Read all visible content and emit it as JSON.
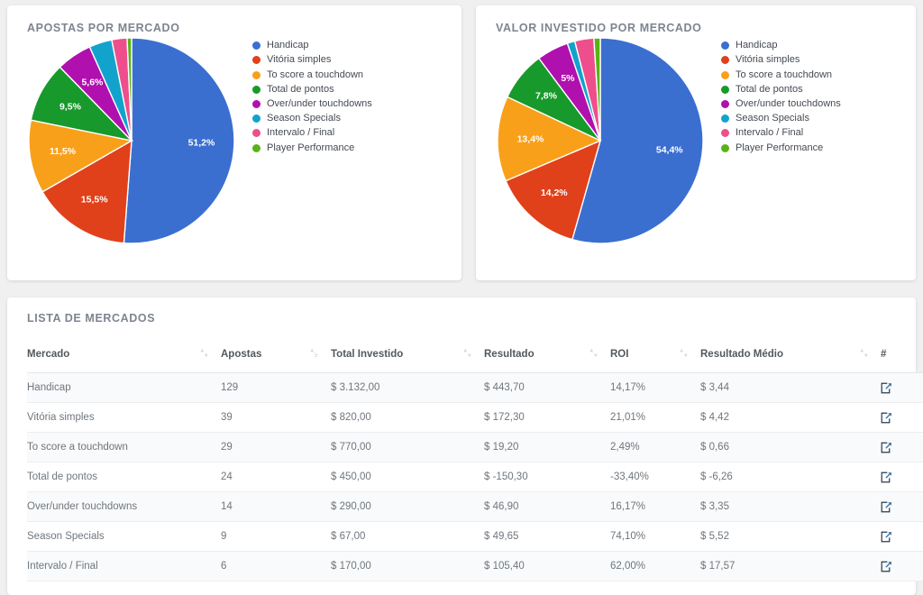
{
  "charts": [
    {
      "id": "apostas-por-mercado",
      "title": "APOSTAS POR MERCADO"
    },
    {
      "id": "valor-investido-por-mercado",
      "title": "VALOR INVESTIDO POR MERCADO"
    }
  ],
  "chart_data": [
    {
      "type": "pie",
      "title": "APOSTAS POR MERCADO",
      "legend_position": "right",
      "start_angle": 0,
      "direction": "clockwise",
      "categories": [
        "Handicap",
        "Vitória simples",
        "To score a touchdown",
        "Total de pontos",
        "Over/under touchdowns",
        "Season Specials",
        "Intervalo / Final",
        "Player Performance"
      ],
      "values": [
        51.2,
        15.5,
        11.5,
        9.5,
        5.6,
        3.6,
        2.4,
        0.7
      ],
      "labels": [
        "51,2%",
        "15,5%",
        "11,5%",
        "9,5%",
        "5,6%",
        "",
        "",
        ""
      ],
      "colors": [
        "#3a6fd0",
        "#e0401a",
        "#f9a01b",
        "#18992b",
        "#b010ae",
        "#12a3cc",
        "#ee4f8c",
        "#59b317"
      ]
    },
    {
      "type": "pie",
      "title": "VALOR INVESTIDO POR MERCADO",
      "legend_position": "right",
      "start_angle": 0,
      "direction": "clockwise",
      "categories": [
        "Handicap",
        "Vitória simples",
        "To score a touchdown",
        "Total de pontos",
        "Over/under touchdowns",
        "Season Specials",
        "Intervalo / Final",
        "Player Performance"
      ],
      "values": [
        54.4,
        14.2,
        13.4,
        7.8,
        5.0,
        1.2,
        3.0,
        1.0
      ],
      "labels": [
        "54,4%",
        "14,2%",
        "13,4%",
        "7,8%",
        "5%",
        "",
        "",
        ""
      ],
      "colors": [
        "#3a6fd0",
        "#e0401a",
        "#f9a01b",
        "#18992b",
        "#b010ae",
        "#12a3cc",
        "#ee4f8c",
        "#59b317"
      ]
    }
  ],
  "table": {
    "title": "LISTA DE MERCADOS",
    "columns": [
      {
        "label": "Mercado",
        "sortable": true,
        "sort_state": "none"
      },
      {
        "label": "Apostas",
        "sortable": true,
        "sort_state": "desc"
      },
      {
        "label": "Total Investido",
        "sortable": true,
        "sort_state": "none"
      },
      {
        "label": "Resultado",
        "sortable": true,
        "sort_state": "none"
      },
      {
        "label": "ROI",
        "sortable": true,
        "sort_state": "none"
      },
      {
        "label": "Resultado Médio",
        "sortable": true,
        "sort_state": "none"
      },
      {
        "label": "#",
        "sortable": false,
        "sort_state": "none"
      }
    ],
    "rows": [
      {
        "mercado": "Handicap",
        "apostas": "129",
        "total_investido": "$ 3.132,00",
        "resultado": "$ 443,70",
        "resultado_sign": "pos",
        "roi": "14,17%",
        "roi_sign": "pos",
        "resultado_medio": "$ 3,44",
        "resultado_medio_sign": "pos",
        "action": "external-link-icon"
      },
      {
        "mercado": "Vitória simples",
        "apostas": "39",
        "total_investido": "$ 820,00",
        "resultado": "$ 172,30",
        "resultado_sign": "pos",
        "roi": "21,01%",
        "roi_sign": "pos",
        "resultado_medio": "$ 4,42",
        "resultado_medio_sign": "pos",
        "action": "external-link-icon"
      },
      {
        "mercado": "To score a touchdown",
        "apostas": "29",
        "total_investido": "$ 770,00",
        "resultado": "$ 19,20",
        "resultado_sign": "pos",
        "roi": "2,49%",
        "roi_sign": "pos",
        "resultado_medio": "$ 0,66",
        "resultado_medio_sign": "pos",
        "action": "external-link-icon"
      },
      {
        "mercado": "Total de pontos",
        "apostas": "24",
        "total_investido": "$ 450,00",
        "resultado": "$ -150,30",
        "resultado_sign": "neg",
        "roi": "-33,40%",
        "roi_sign": "neg",
        "resultado_medio": "$ -6,26",
        "resultado_medio_sign": "neg",
        "action": "external-link-icon"
      },
      {
        "mercado": "Over/under touchdowns",
        "apostas": "14",
        "total_investido": "$ 290,00",
        "resultado": "$ 46,90",
        "resultado_sign": "pos",
        "roi": "16,17%",
        "roi_sign": "pos",
        "resultado_medio": "$ 3,35",
        "resultado_medio_sign": "pos",
        "action": "external-link-icon"
      },
      {
        "mercado": "Season Specials",
        "apostas": "9",
        "total_investido": "$ 67,00",
        "resultado": "$ 49,65",
        "resultado_sign": "pos",
        "roi": "74,10%",
        "roi_sign": "pos",
        "resultado_medio": "$ 5,52",
        "resultado_medio_sign": "pos",
        "action": "external-link-icon"
      },
      {
        "mercado": "Intervalo / Final",
        "apostas": "6",
        "total_investido": "$ 170,00",
        "resultado": "$ 105,40",
        "resultado_sign": "pos",
        "roi": "62,00%",
        "roi_sign": "pos",
        "resultado_medio": "$ 17,57",
        "resultado_medio_sign": "pos",
        "action": "external-link-icon"
      }
    ]
  },
  "theme": {
    "page_bg": "#f0f0f0",
    "card_bg": "#ffffff",
    "title_color": "#7c8590",
    "positive_color": "#4caf67",
    "negative_color": "#e8595e"
  }
}
